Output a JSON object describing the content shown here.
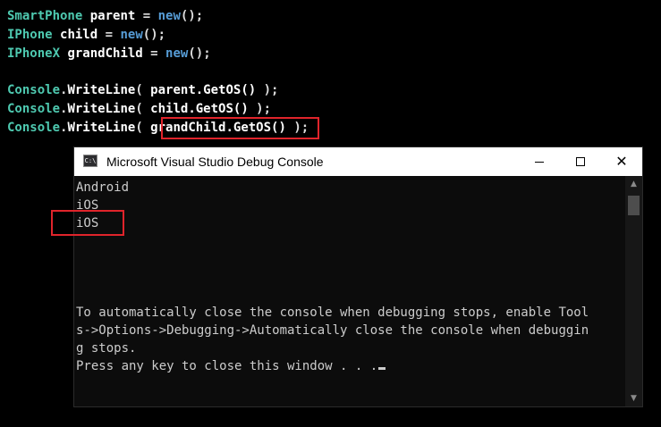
{
  "code": {
    "line1": {
      "type": "SmartPhone",
      "var": "parent",
      "eq": " = ",
      "kw": "new",
      "tail": "();"
    },
    "line2": {
      "type": "IPhone",
      "var": "child",
      "eq": " = ",
      "kw": "new",
      "tail": "();"
    },
    "line3": {
      "type": "IPhoneX",
      "var": "grandChild",
      "eq": " = ",
      "kw": "new",
      "tail": "();"
    },
    "line4": {
      "cls": "Console",
      "dot": ".",
      "method": "WriteLine",
      "open": "( ",
      "arg": "parent.GetOS()",
      "close": " );"
    },
    "line5": {
      "cls": "Console",
      "dot": ".",
      "method": "WriteLine",
      "open": "( ",
      "arg": "child.GetOS()",
      "close": " );"
    },
    "line6": {
      "cls": "Console",
      "dot": ".",
      "method": "WriteLine",
      "open": "( ",
      "arg": "grandChild.GetOS()",
      "close": " );"
    }
  },
  "console": {
    "title": "Microsoft Visual Studio Debug Console",
    "icon_text": "C:\\",
    "window_buttons": {
      "minimize_icon": "minimize-icon",
      "maximize_icon": "maximize-icon",
      "close_icon": "close-icon",
      "close_glyph": "✕"
    },
    "output": [
      "Android",
      "iOS",
      "iOS",
      "To automatically close the console when debugging stops, enable Tool",
      "s->Options->Debugging->Automatically close the console when debuggin",
      "g stops.",
      "Press any key to close this window . . ."
    ],
    "scroll_up_glyph": "▲",
    "scroll_down_glyph": "▼"
  },
  "colors": {
    "highlight": "#e0242b",
    "type": "#4ec9b0",
    "keyword": "#569cd6",
    "console_bg": "#0c0c0c",
    "console_text": "#cccccc"
  }
}
